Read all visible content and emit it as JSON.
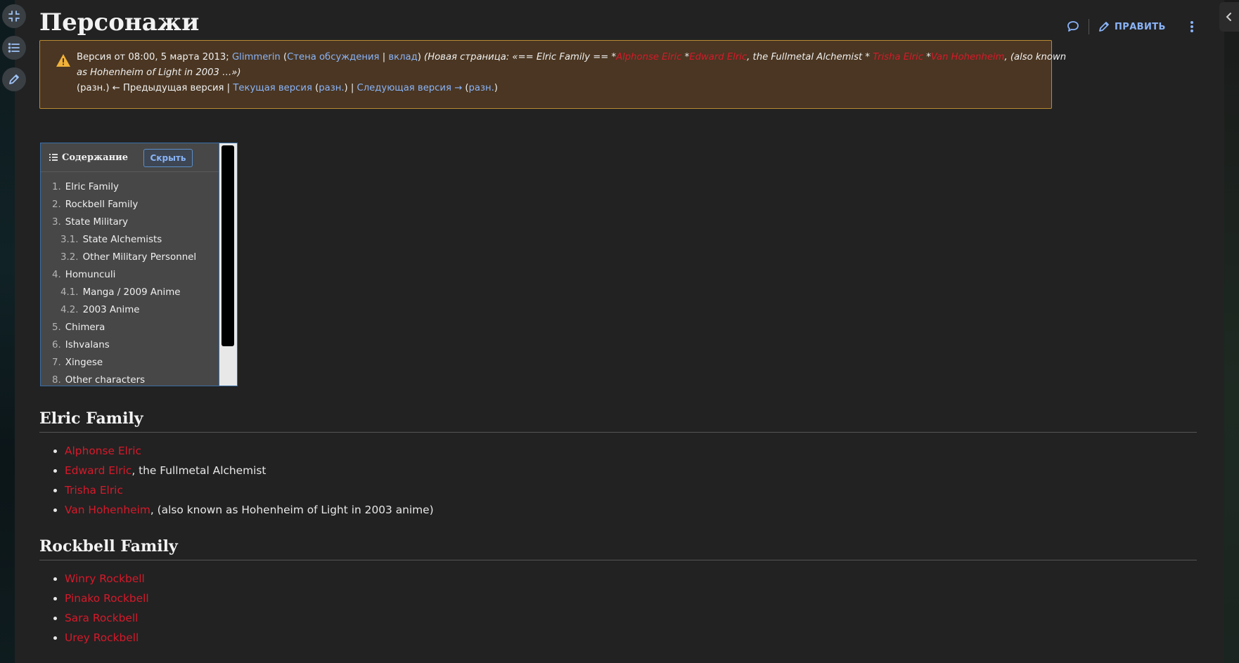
{
  "page": {
    "title": "Персонажи",
    "edit_label": "ПРАВИТЬ"
  },
  "notice": {
    "version_text": "Версия от 08:00, 5 марта 2013; ",
    "user": "Glimmerin",
    "p_open": " (",
    "talk": "Стена обсуждения",
    "pipe": " | ",
    "contrib": "вклад",
    "p_close": ") ",
    "summary_a": "(Новая страница: «== Elric Family == *",
    "link_alphonse": "Alphonse Elric",
    "summary_b": " *",
    "link_edward": "Edward Elric",
    "summary_c": ", the Fullmetal Alchemist * ",
    "link_trisha": "Trisha Elric",
    "summary_d": " *",
    "link_van": "Van Hohenheim",
    "summary_e": ", (also known",
    "summary_line2": "as Hohenheim of Light in 2003 …»)",
    "nav_diff": "(разн.) ← Предыдущая версия | ",
    "nav_current": "Текущая версия",
    "nav_p_open": " (",
    "nav_diff2": "разн.",
    "nav_mid": ") | ",
    "nav_next": "Следующая версия →",
    "nav_p_open2": " (",
    "nav_diff3": "разн.",
    "nav_close": ")"
  },
  "toc": {
    "title": "Содержание",
    "hide_label": "Скрыть",
    "items": [
      {
        "num": "1.",
        "text": "Elric Family"
      },
      {
        "num": "2.",
        "text": "Rockbell Family"
      },
      {
        "num": "3.",
        "text": "State Military"
      },
      {
        "num": "3.1.",
        "text": "State Alchemists"
      },
      {
        "num": "3.2.",
        "text": "Other Military Personnel"
      },
      {
        "num": "4.",
        "text": "Homunculi"
      },
      {
        "num": "4.1.",
        "text": "Manga / 2009 Anime"
      },
      {
        "num": "4.2.",
        "text": "2003 Anime"
      },
      {
        "num": "5.",
        "text": "Chimera"
      },
      {
        "num": "6.",
        "text": "Ishvalans"
      },
      {
        "num": "7.",
        "text": "Xingese"
      },
      {
        "num": "8.",
        "text": "Other characters"
      }
    ]
  },
  "sections": [
    {
      "heading": "Elric Family",
      "items": [
        {
          "link": "Alphonse Elric",
          "suffix": ""
        },
        {
          "link": "Edward Elric",
          "suffix": ", the Fullmetal Alchemist"
        },
        {
          "link": "Trisha Elric",
          "suffix": ""
        },
        {
          "link": "Van Hohenheim",
          "suffix": ", (also known as Hohenheim of Light in 2003 anime)"
        }
      ]
    },
    {
      "heading": "Rockbell Family",
      "items": [
        {
          "link": "Winry Rockbell",
          "suffix": ""
        },
        {
          "link": "Pinako Rockbell",
          "suffix": ""
        },
        {
          "link": "Sara Rockbell",
          "suffix": ""
        },
        {
          "link": "Urey Rockbell",
          "suffix": ""
        }
      ]
    }
  ],
  "colors": {
    "background": "#222222",
    "link": "#8ab4f8",
    "redlink": "#d7192a",
    "notice_bg": "#4a3622",
    "notice_border": "#b98a33"
  }
}
